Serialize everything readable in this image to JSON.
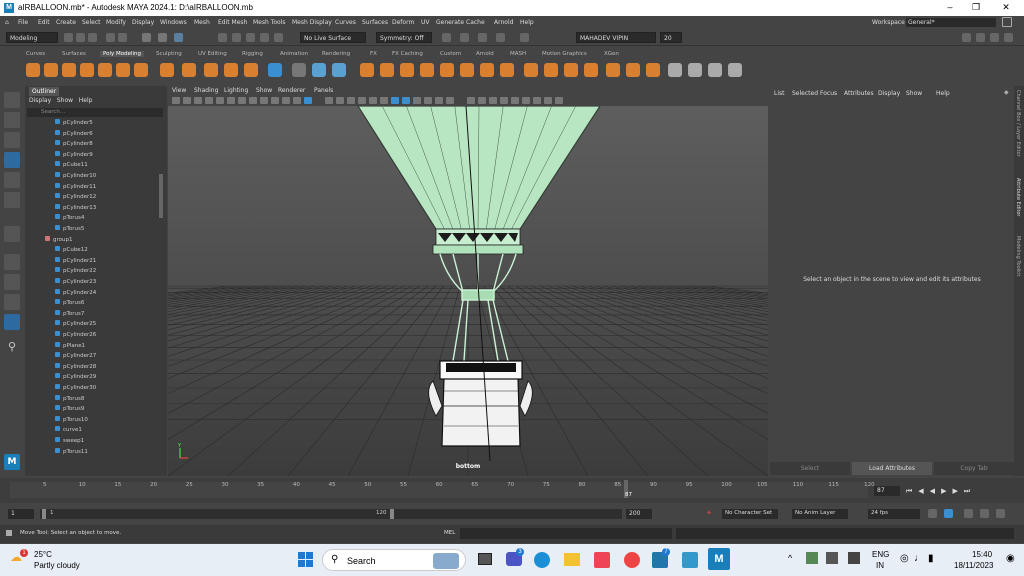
{
  "window": {
    "title": "aIRBALLOON.mb* - Autodesk MAYA 2024.1: D:\\aIRBALLOON.mb",
    "logo": "M"
  },
  "menus": [
    "File",
    "Edit",
    "Create",
    "Select",
    "Modify",
    "Display",
    "Windows",
    "Mesh",
    "Edit Mesh",
    "Mesh Tools",
    "Mesh Display",
    "Curves",
    "Surfaces",
    "Deform",
    "UV",
    "Generate",
    "Cache",
    "Arnold",
    "Help"
  ],
  "workspace": {
    "label": "Workspace :",
    "value": "General*"
  },
  "status_line": {
    "mode": "Modeling",
    "live": "No Live Surface",
    "symmetry": "Symmetry: Off",
    "user": "MAHADEV VIPIN",
    "counter": "20"
  },
  "shelf_tabs": [
    "Curves",
    "Surfaces",
    "Poly Modeling",
    "Sculpting",
    "UV Editing",
    "Rigging",
    "Animation",
    "Rendering",
    "FX",
    "FX Caching",
    "Custom",
    "Arnold",
    "MASH",
    "Motion Graphics",
    "XGen"
  ],
  "outliner": {
    "tab": "Outliner",
    "menu": [
      "Display",
      "Show",
      "Help"
    ],
    "search_placeholder": "Search...",
    "items": [
      "pCylinder5",
      "pCylinder6",
      "pCylinder8",
      "pCylinder9",
      "pCube11",
      "pCylinder10",
      "pCylinder11",
      "pCylinder12",
      "pCylinder13",
      "pTorus4",
      "pTorus5",
      "group1",
      "pCube12",
      "pCylinder21",
      "pCylinder22",
      "pCylinder23",
      "pCylinder24",
      "pTorus6",
      "pTorus7",
      "pCylinder25",
      "pCylinder26",
      "pPlane1",
      "pCylinder27",
      "pCylinder28",
      "pCylinder29",
      "pCylinder30",
      "pTorus8",
      "pTorus9",
      "pTorus10",
      "curve1",
      "sweep1",
      "pTorus11"
    ]
  },
  "viewport": {
    "menu": [
      "View",
      "Shading",
      "Lighting",
      "Show",
      "Renderer",
      "Panels"
    ],
    "camera_label": "bottom"
  },
  "attribute_editor": {
    "menu": [
      "List",
      "Selected",
      "Focus",
      "Attributes",
      "Display",
      "Show",
      "Help"
    ],
    "message": "Select an object in the scene to view and edit its attributes",
    "buttons": [
      "Select",
      "Load Attributes",
      "Copy Tab"
    ]
  },
  "side_tabs": [
    "Channel Box / Layer Editor",
    "Attribute Editor",
    "Modeling Toolkit"
  ],
  "timeline": {
    "ticks": [
      "5",
      "10",
      "15",
      "20",
      "25",
      "30",
      "35",
      "40",
      "45",
      "50",
      "55",
      "60",
      "65",
      "70",
      "75",
      "80",
      "85",
      "90",
      "95",
      "100",
      "105",
      "110",
      "115",
      "120"
    ],
    "current_frame": "87",
    "frame_field": "87"
  },
  "range": {
    "start": "1",
    "start2": "1",
    "end_mid": "120",
    "end": "200",
    "character_set": "No Character Set",
    "anim_layer": "No Anim Layer",
    "fps": "24 fps"
  },
  "command_line": {
    "help": "Move Tool: Select an object to move.",
    "mel": "MEL"
  },
  "taskbar": {
    "temp": "25°C",
    "weather": "Partly cloudy",
    "search": "Search",
    "lang1": "ENG",
    "lang2": "IN",
    "time": "15:40",
    "date": "18/11/2023",
    "notif": "1",
    "badge1": "3",
    "badge2": "7"
  }
}
